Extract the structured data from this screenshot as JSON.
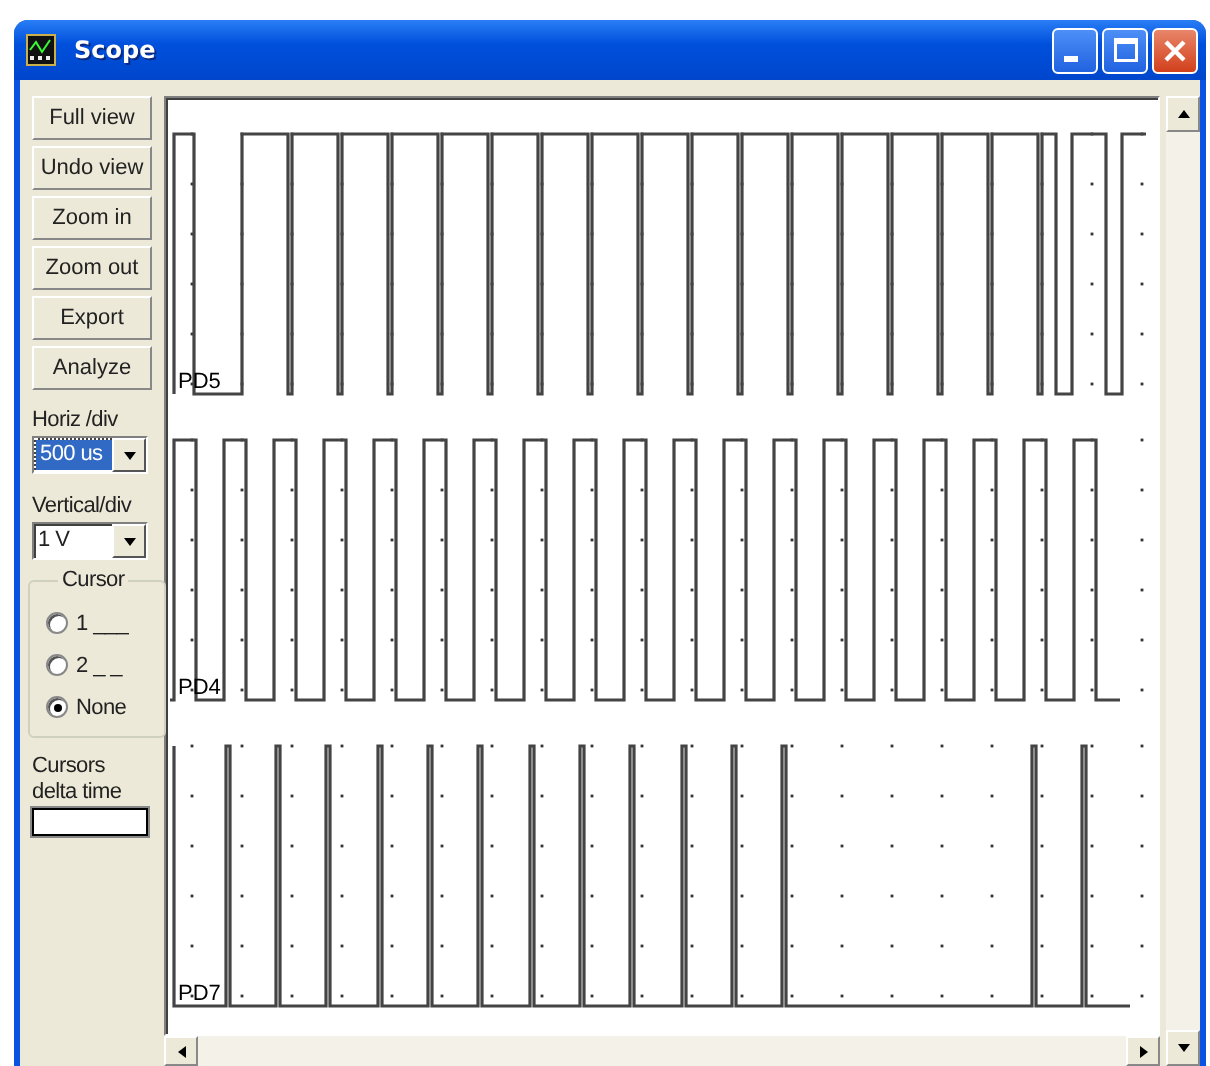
{
  "window": {
    "title": "Scope"
  },
  "buttons": [
    "Full view",
    "Undo view",
    "Zoom in",
    "Zoom out",
    "Export",
    "Analyze"
  ],
  "horizontal": {
    "label": "Horiz /div",
    "value": "500 us",
    "focused": true
  },
  "vertical": {
    "label": "Vertical/div",
    "value": "1 V",
    "focused": false
  },
  "cursor": {
    "title": "Cursor",
    "options": [
      {
        "label": "1 ___",
        "selected": false
      },
      {
        "label": "2 _ _",
        "selected": false
      },
      {
        "label": "None",
        "selected": true
      }
    ]
  },
  "delta": {
    "label": "Cursors delta time"
  },
  "channels": [
    {
      "label": "PD5",
      "kind": "dips"
    },
    {
      "label": "PD4",
      "kind": "square"
    },
    {
      "label": "PD7",
      "kind": "spikes"
    }
  ]
}
